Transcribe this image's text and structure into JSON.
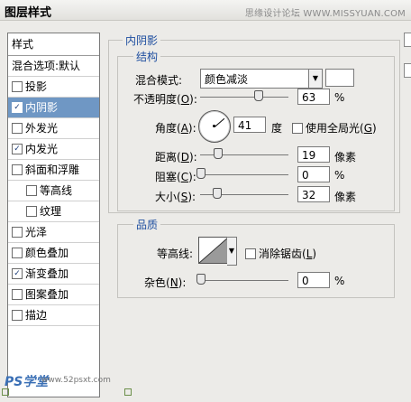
{
  "window": {
    "title": "图层样式",
    "watermark": "思缘设计论坛 WWW.MISSYUAN.COM"
  },
  "styles_panel": {
    "header": "样式",
    "blend_options": "混合选项:默认",
    "items": [
      {
        "label": "投影",
        "checked": false,
        "selected": false,
        "sub": false
      },
      {
        "label": "内阴影",
        "checked": true,
        "selected": true,
        "sub": false
      },
      {
        "label": "外发光",
        "checked": false,
        "selected": false,
        "sub": false
      },
      {
        "label": "内发光",
        "checked": true,
        "selected": false,
        "sub": false
      },
      {
        "label": "斜面和浮雕",
        "checked": false,
        "selected": false,
        "sub": false
      },
      {
        "label": "等高线",
        "checked": false,
        "selected": false,
        "sub": true
      },
      {
        "label": "纹理",
        "checked": false,
        "selected": false,
        "sub": true
      },
      {
        "label": "光泽",
        "checked": false,
        "selected": false,
        "sub": false
      },
      {
        "label": "颜色叠加",
        "checked": false,
        "selected": false,
        "sub": false
      },
      {
        "label": "渐变叠加",
        "checked": true,
        "selected": false,
        "sub": false
      },
      {
        "label": "图案叠加",
        "checked": false,
        "selected": false,
        "sub": false
      },
      {
        "label": "描边",
        "checked": false,
        "selected": false,
        "sub": false
      }
    ]
  },
  "logo": {
    "ps": "PS学堂",
    "url": "www.52psxt.com"
  },
  "inner_shadow": {
    "group_title": "内阴影",
    "structure": {
      "title": "结构",
      "blend_mode_label": "混合模式:",
      "blend_mode_value": "颜色减淡",
      "blend_color": "#ffffff",
      "opacity_label_a": "不透明度(",
      "opacity_key": "O",
      "opacity_label_b": "):",
      "opacity_value": "63",
      "opacity_unit": "%",
      "angle_label_a": "角度(",
      "angle_key": "A",
      "angle_label_b": "):",
      "angle_value": "41",
      "angle_unit": "度",
      "global_light_label_a": "使用全局光(",
      "global_light_key": "G",
      "global_light_label_b": ")",
      "distance_label_a": "距离(",
      "distance_key": "D",
      "distance_label_b": "):",
      "distance_value": "19",
      "distance_unit": "像素",
      "choke_label_a": "阻塞(",
      "choke_key": "C",
      "choke_label_b": "):",
      "choke_value": "0",
      "choke_unit": "%",
      "size_label_a": "大小(",
      "size_key": "S",
      "size_label_b": "):",
      "size_value": "32",
      "size_unit": "像素"
    },
    "quality": {
      "title": "品质",
      "contour_label": "等高线:",
      "anti_alias_label_a": "消除锯齿(",
      "anti_alias_key": "L",
      "anti_alias_label_b": ")",
      "noise_label_a": "杂色(",
      "noise_key": "N",
      "noise_label_b": "):",
      "noise_value": "0",
      "noise_unit": "%"
    }
  }
}
